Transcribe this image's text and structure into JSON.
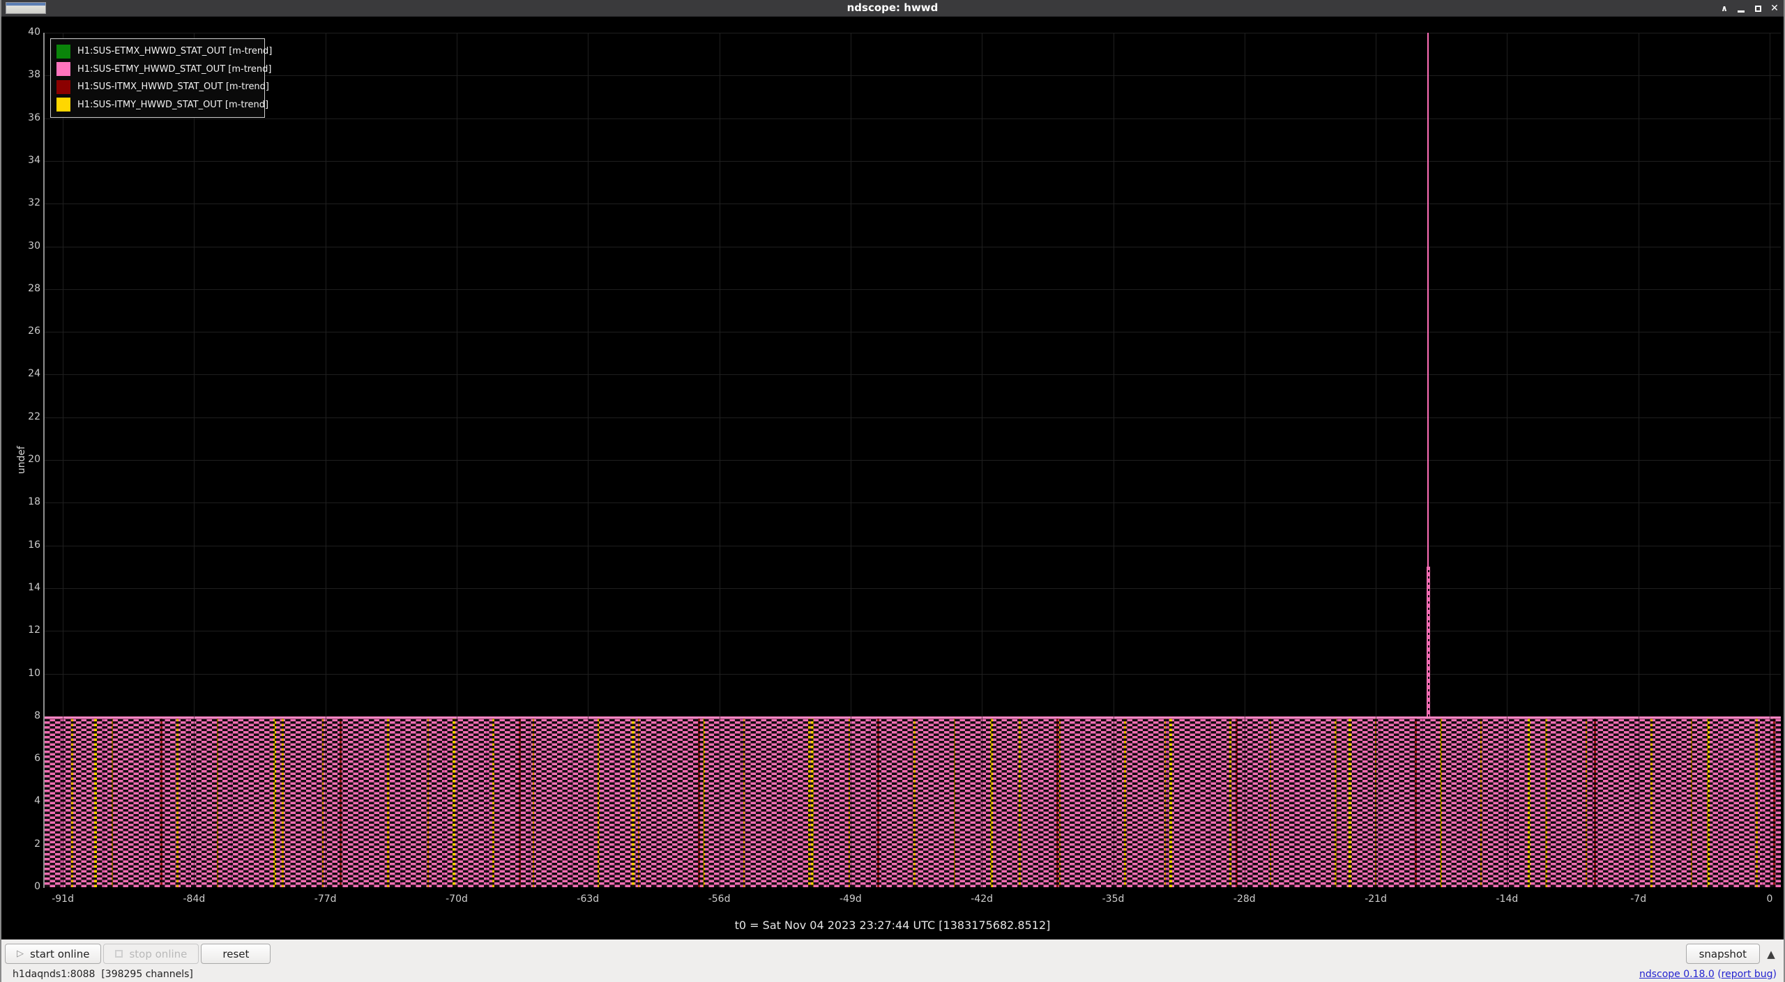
{
  "window": {
    "title": "ndscope: hwwd"
  },
  "chart_data": {
    "type": "line",
    "title": "",
    "ylabel": "undef",
    "ylim": [
      0,
      40
    ],
    "grid": true,
    "legend_position": "top-left",
    "y_ticks": [
      0,
      2,
      4,
      6,
      8,
      10,
      12,
      14,
      16,
      18,
      20,
      22,
      24,
      26,
      28,
      30,
      32,
      34,
      36,
      38,
      40
    ],
    "x_ticks": [
      {
        "day": -91,
        "label": "-91d"
      },
      {
        "day": -84,
        "label": "-84d"
      },
      {
        "day": -77,
        "label": "-77d"
      },
      {
        "day": -70,
        "label": "-70d"
      },
      {
        "day": -63,
        "label": "-63d"
      },
      {
        "day": -56,
        "label": "-56d"
      },
      {
        "day": -49,
        "label": "-49d"
      },
      {
        "day": -42,
        "label": "-42d"
      },
      {
        "day": -35,
        "label": "-35d"
      },
      {
        "day": -28,
        "label": "-28d"
      },
      {
        "day": -21,
        "label": "-21d"
      },
      {
        "day": -14,
        "label": "-14d"
      },
      {
        "day": -7,
        "label": "-7d"
      },
      {
        "day": 0,
        "label": "0"
      }
    ],
    "series": [
      {
        "name": "H1:SUS-ETMX_HWWD_STAT_OUT [m-trend]",
        "color": "#0a840a"
      },
      {
        "name": "H1:SUS-ETMY_HWWD_STAT_OUT [m-trend]",
        "color": "#ff74be"
      },
      {
        "name": "H1:SUS-ITMX_HWWD_STAT_OUT [m-trend]",
        "color": "#8b0000"
      },
      {
        "name": "H1:SUS-ITMY_HWWD_STAT_OUT [m-trend]",
        "color": "#ffd700"
      }
    ],
    "band": {
      "description": "all four channels oscillate densely between 0 and 8 across the full 91-day span",
      "ymin": 0,
      "ymax": 8
    },
    "spike": {
      "channel": "H1:SUS-ETMY_HWWD_STAT_OUT",
      "day": -18.2,
      "thin_peak_value": 40,
      "solid_peak_value": 15
    },
    "t0_label": "t0 = Sat Nov 04 2023 23:27:44 UTC [1383175682.8512]"
  },
  "toolbar": {
    "start_label": "start online",
    "stop_label": "stop online",
    "reset_label": "reset",
    "snapshot_label": "snapshot",
    "panel_toggle": "▲"
  },
  "statusbar": {
    "server": "h1daqnds1:8088  [398295 channels]",
    "version_link": "ndscope 0.18.0",
    "pre_bug": " (",
    "bug_link": "report bug",
    "post_bug": ")"
  },
  "colors": {
    "canvas_bg": "#000000",
    "grid": "#1e1e1e",
    "band_pink": "#f06db2",
    "titlebar_bg": "#3a3a3c",
    "toolbar_bg": "#efeeed",
    "link_blue": "#2323cf"
  }
}
